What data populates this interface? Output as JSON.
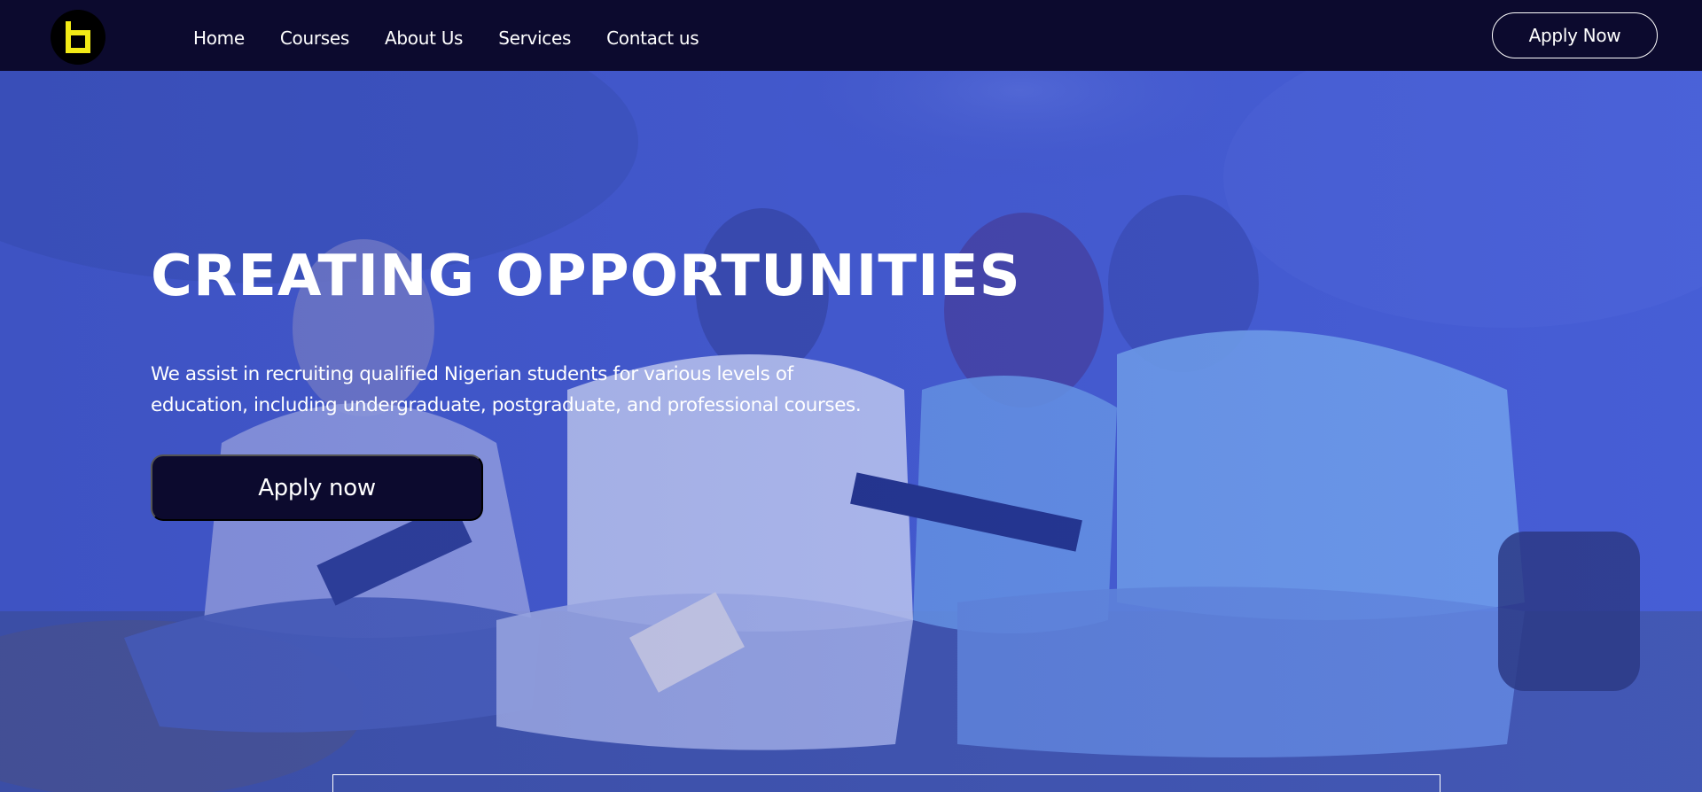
{
  "brand": {
    "logo_icon": "b-logo-icon",
    "logo_color": "#f2ea16"
  },
  "nav": {
    "items": [
      {
        "label": "Home"
      },
      {
        "label": "Courses"
      },
      {
        "label": "About Us"
      },
      {
        "label": "Services"
      },
      {
        "label": "Contact us"
      }
    ],
    "apply_label": "Apply Now"
  },
  "hero": {
    "title": "CREATING OPPORTUNITIES",
    "description": "We assist in recruiting qualified Nigerian students for various levels of education, including undergraduate, postgraduate, and professional courses.",
    "cta_label": "Apply now"
  },
  "colors": {
    "navy": "#0c0a2e",
    "hero_tint": "#4a62da",
    "text": "#ffffff"
  }
}
